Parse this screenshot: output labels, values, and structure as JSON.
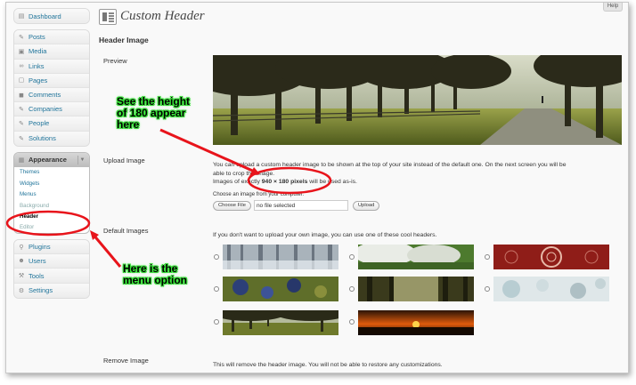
{
  "sidebar": {
    "dashboard": "Dashboard",
    "group1": [
      "Posts",
      "Media",
      "Links",
      "Pages",
      "Comments",
      "Companies",
      "People",
      "Solutions"
    ],
    "appearance": "Appearance",
    "appearance_sub": [
      "Themes",
      "Widgets",
      "Menus",
      "Background",
      "Header",
      "Editor"
    ],
    "group3": [
      "Plugins",
      "Users",
      "Tools",
      "Settings"
    ]
  },
  "help": "Help",
  "page_title": "Custom Header",
  "section_title": "Header Image",
  "labels": {
    "preview": "Preview",
    "upload": "Upload Image",
    "default_images": "Default Images",
    "remove": "Remove Image"
  },
  "upload": {
    "line1": "You can upload a custom header image to be shown at the top of your site instead of the default one. On the next screen you will be",
    "line2": "able to crop the image.",
    "line3_pre": "Images of exactly ",
    "line3_bold": "940 × 180 pixels",
    "line3_post": " will be used as-is.",
    "choose_label": "Choose an image from your computer:",
    "choose_file_btn": "Choose File",
    "file_status": "no file selected",
    "upload_btn": "Upload"
  },
  "default_images_text": "If you don't want to upload your own image, you can use one of these cool headers.",
  "remove_text": "This will remove the header image. You will not be able to restore any customizations.",
  "annotations": {
    "height_note": [
      "See the height",
      "of 180 appear",
      "here"
    ],
    "menu_note": [
      "Here is the",
      "menu option"
    ]
  },
  "colors": {
    "link": "#21759b",
    "annotation_red": "#e8141b",
    "annotation_green": "#36e836"
  }
}
